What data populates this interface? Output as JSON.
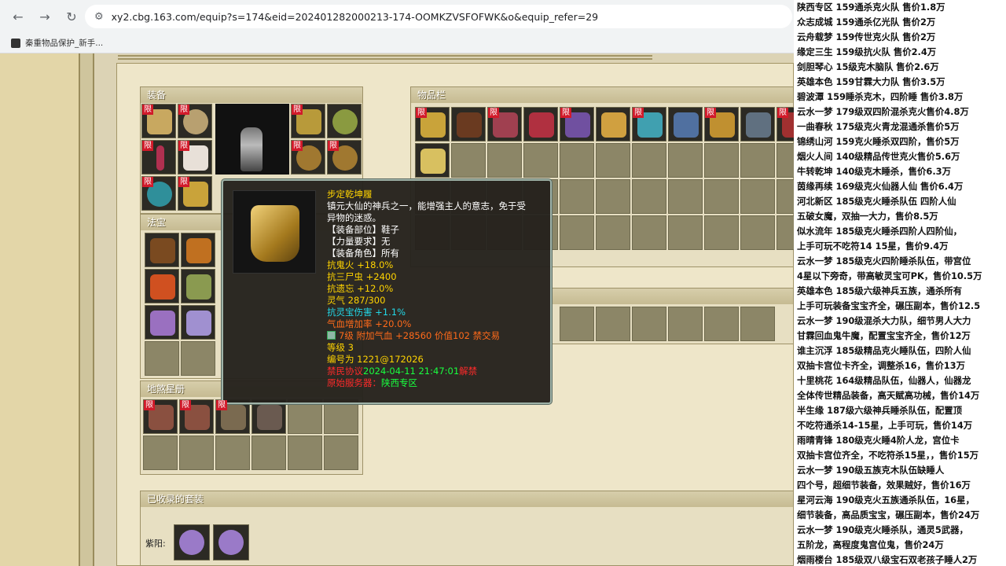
{
  "browser": {
    "url": "xy2.cbg.163.com/equip?s=174&eid=202401282000213-174-OOMKZVSFOFWK&o&equip_refer=29",
    "bookmark": "秦重物品保护_新手..."
  },
  "equipment": {
    "title": "装备",
    "badge": "限"
  },
  "fabao": {
    "title": "法宝"
  },
  "disha": {
    "title": "地煞星册"
  },
  "inventory": {
    "title": "物品栏"
  },
  "suits": {
    "title": "已收录的套装",
    "label": "紫阳:"
  },
  "tooltip": {
    "name": "步定乾坤履",
    "desc1": "镇元大仙的神兵之一，能增强主人的意志，免于受",
    "desc2": "异物的迷惑。",
    "slot": "【装备部位】鞋子",
    "strength": "【力量要求】无",
    "role": "【装备角色】所有",
    "attr1": "抗鬼火 +18.0%",
    "attr2": "抗三尸虫 +2400",
    "attr3": "抗遗忘 +12.0%",
    "spirit": "灵气 287/300",
    "attr_cyan": "抗灵宝伤害 +1.1%",
    "attr_orange": "气血增加率 +20.0%",
    "gem_line": "7级 附加气血 +28560 价值102 禁交易",
    "level": "等级 3",
    "serial": "编号为 1221@172026",
    "trade_label": "禁民协议",
    "trade_time": "2024-04-11 21:47:01",
    "trade_suffix": "解禁",
    "origin_label": "原始服务器：",
    "origin_server": "陕西专区"
  },
  "chat": [
    "陕西专区 159通杀克火队 售价1.8万",
    "众志成城 159通杀亿光队 售价2万",
    "云舟载梦 159传世克火队 售价2万",
    "缘定三生 159级抗火队 售价2.4万",
    "剑胆琴心 15级克木脑队 售价2.6万",
    "英雄本色 159甘霖大力队 售价3.5万",
    "碧波潭 159睡杀克木，四阶睡 售价3.8万",
    "云水一梦 179级双四阶混杀克火售价4.8万",
    "一曲春秋 175级克火青龙混通杀售价5万",
    "锦绣山河 159克火睡杀双四阶，售价5万",
    "烟火人间 140级精品传世克火售价5.6万",
    "牛转乾坤 140级克木睡杀，售价6.3万",
    "茵缘再续 169级克火仙器人仙 售价6.4万",
    "河北新区 185级克火睡杀队伍 四阶人仙",
    "五破女魔，双抽一大力，售价8.5万",
    "似水流年 185级克火睡杀四阶人四阶仙，",
    "上手可玩不吃符14 15星，售价9.4万",
    "云水一梦 185级克火四阶睡杀队伍，带宫位",
    "4星以下旁奇，带高敏灵宝可PK，售价10.5万",
    "英雄本色 185级六级神兵五族，通杀所有",
    "上手可玩装备宝宝齐全，碾压副本，售价12.5",
    "云水一梦 190级混杀大力队，细节男人大力",
    "甘霖回血鬼牛魔，配置宝宝齐全，售价12万",
    "谁主沉浮 185级精品克火睡队伍，四阶人仙",
    "双抽卡宫位卡齐全，调整杀16，售价13万",
    "十里桃花 164级精品队伍，仙器人，仙器龙",
    "全体传世精品装备，高天赋高功械，售价14万",
    "半生缘 187级六级神兵睡杀队伍，配置顶",
    "不吃符通杀14-15星，上手可玩，售价14万",
    "雨晴青锋 180级克火睡4阶人龙，宫位卡",
    "双抽卡宫位齐全，不吃符杀15星，，售价15万",
    "云水一梦 190级五族克木队伍缺睡人",
    "四个号，超细节装备，效果贼好，售价16万",
    "星河云海 190级克火五族通杀队伍，16星，",
    "细节装备，高品质宝宝，碾压副本，售价24万",
    "云水一梦 190级克火睡杀队，通灵5武器，",
    "五阶龙，高程度鬼宫位鬼，售价24万",
    "烟雨楼台 185级双八级宝石双老孩子睡人2万"
  ],
  "colors": {
    "tooltip_bg": "#24211c",
    "yellow": "#ffd400",
    "cyan": "#22d8e8",
    "orange": "#ff6a1a",
    "green": "#19ff3f",
    "red": "#ff2a2a",
    "badge": "#d11a2a"
  }
}
